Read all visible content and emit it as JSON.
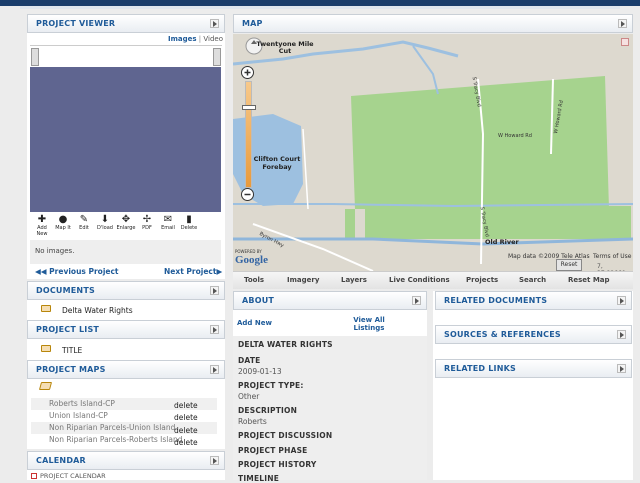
{
  "colors": {
    "accent": "#1f5b99",
    "topbar": "#1a3d6b",
    "viewer_bg": "#5f6590",
    "map_green": "#a6d38e",
    "map_water": "#9dc0e0"
  },
  "viewer": {
    "title": "PROJECT VIEWER",
    "images_link": "Images",
    "separator": "|",
    "video_link": "Video",
    "no_images": "No images.",
    "prev": "Previous Project",
    "next": "Next Project",
    "toolbar": [
      {
        "label": "Add New",
        "icon": "plus-icon"
      },
      {
        "label": "Map It",
        "icon": "globe-icon"
      },
      {
        "label": "Edit",
        "icon": "edit-icon"
      },
      {
        "label": "D'load",
        "icon": "download-icon"
      },
      {
        "label": "Enlarge",
        "icon": "enlarge-icon"
      },
      {
        "label": "PDF",
        "icon": "pdf-icon"
      },
      {
        "label": "Email",
        "icon": "email-icon"
      },
      {
        "label": "Delete",
        "icon": "trash-icon"
      }
    ]
  },
  "documents": {
    "title": "DOCUMENTS",
    "items": [
      "Delta Water Rights"
    ]
  },
  "project_list": {
    "title": "PROJECT LIST",
    "items": [
      "TITLE"
    ]
  },
  "project_maps": {
    "title": "PROJECT MAPS",
    "rows": [
      {
        "name": "Roberts Island-CP",
        "action": "delete"
      },
      {
        "name": "Union Island-CP",
        "action": "delete"
      },
      {
        "name": "Non Riparian Parcels-Union Island",
        "action": "delete"
      },
      {
        "name": "Non Riparian Parcels-Roberts Island",
        "action": "delete"
      }
    ]
  },
  "calendar": {
    "title": "CALENDAR",
    "item": "PROJECT CALENDAR"
  },
  "map": {
    "title": "MAP",
    "places": [
      "Twentyone Mile Cut",
      "Clifton Court Forebay",
      "Old River",
      "W Howard Rd",
      "Byron Hwy"
    ],
    "road_labels": [
      "S Tracy Blvd",
      "W Howard Rd",
      "S Tracy Blvd"
    ],
    "attribution": "Map data ©2009 Tele Atlas",
    "terms": "Terms of Use",
    "coords": "7, 37.82660",
    "reset": "Reset",
    "powered_by": "POWERED BY",
    "google": "Google",
    "tabs": [
      "Tools",
      "Imagery",
      "Layers",
      "Live Conditions",
      "Projects",
      "Search",
      "Reset Map"
    ]
  },
  "about": {
    "title": "ABOUT",
    "add_new": "Add New",
    "view_all": "View All Listings",
    "project_name": "DELTA WATER RIGHTS",
    "date_label": "DATE",
    "date": "2009-01-13",
    "type_label": "PROJECT TYPE:",
    "type": "Other",
    "desc_label": "DESCRIPTION",
    "desc": "Roberts",
    "discussion_label": "PROJECT DISCUSSION",
    "phase_label": "PROJECT PHASE",
    "history_label": "PROJECT HISTORY",
    "timeline_label": "TIMELINE"
  },
  "related": {
    "documents": "RELATED DOCUMENTS",
    "sources": "SOURCES & REFERENCES",
    "links": "RELATED LINKS"
  }
}
